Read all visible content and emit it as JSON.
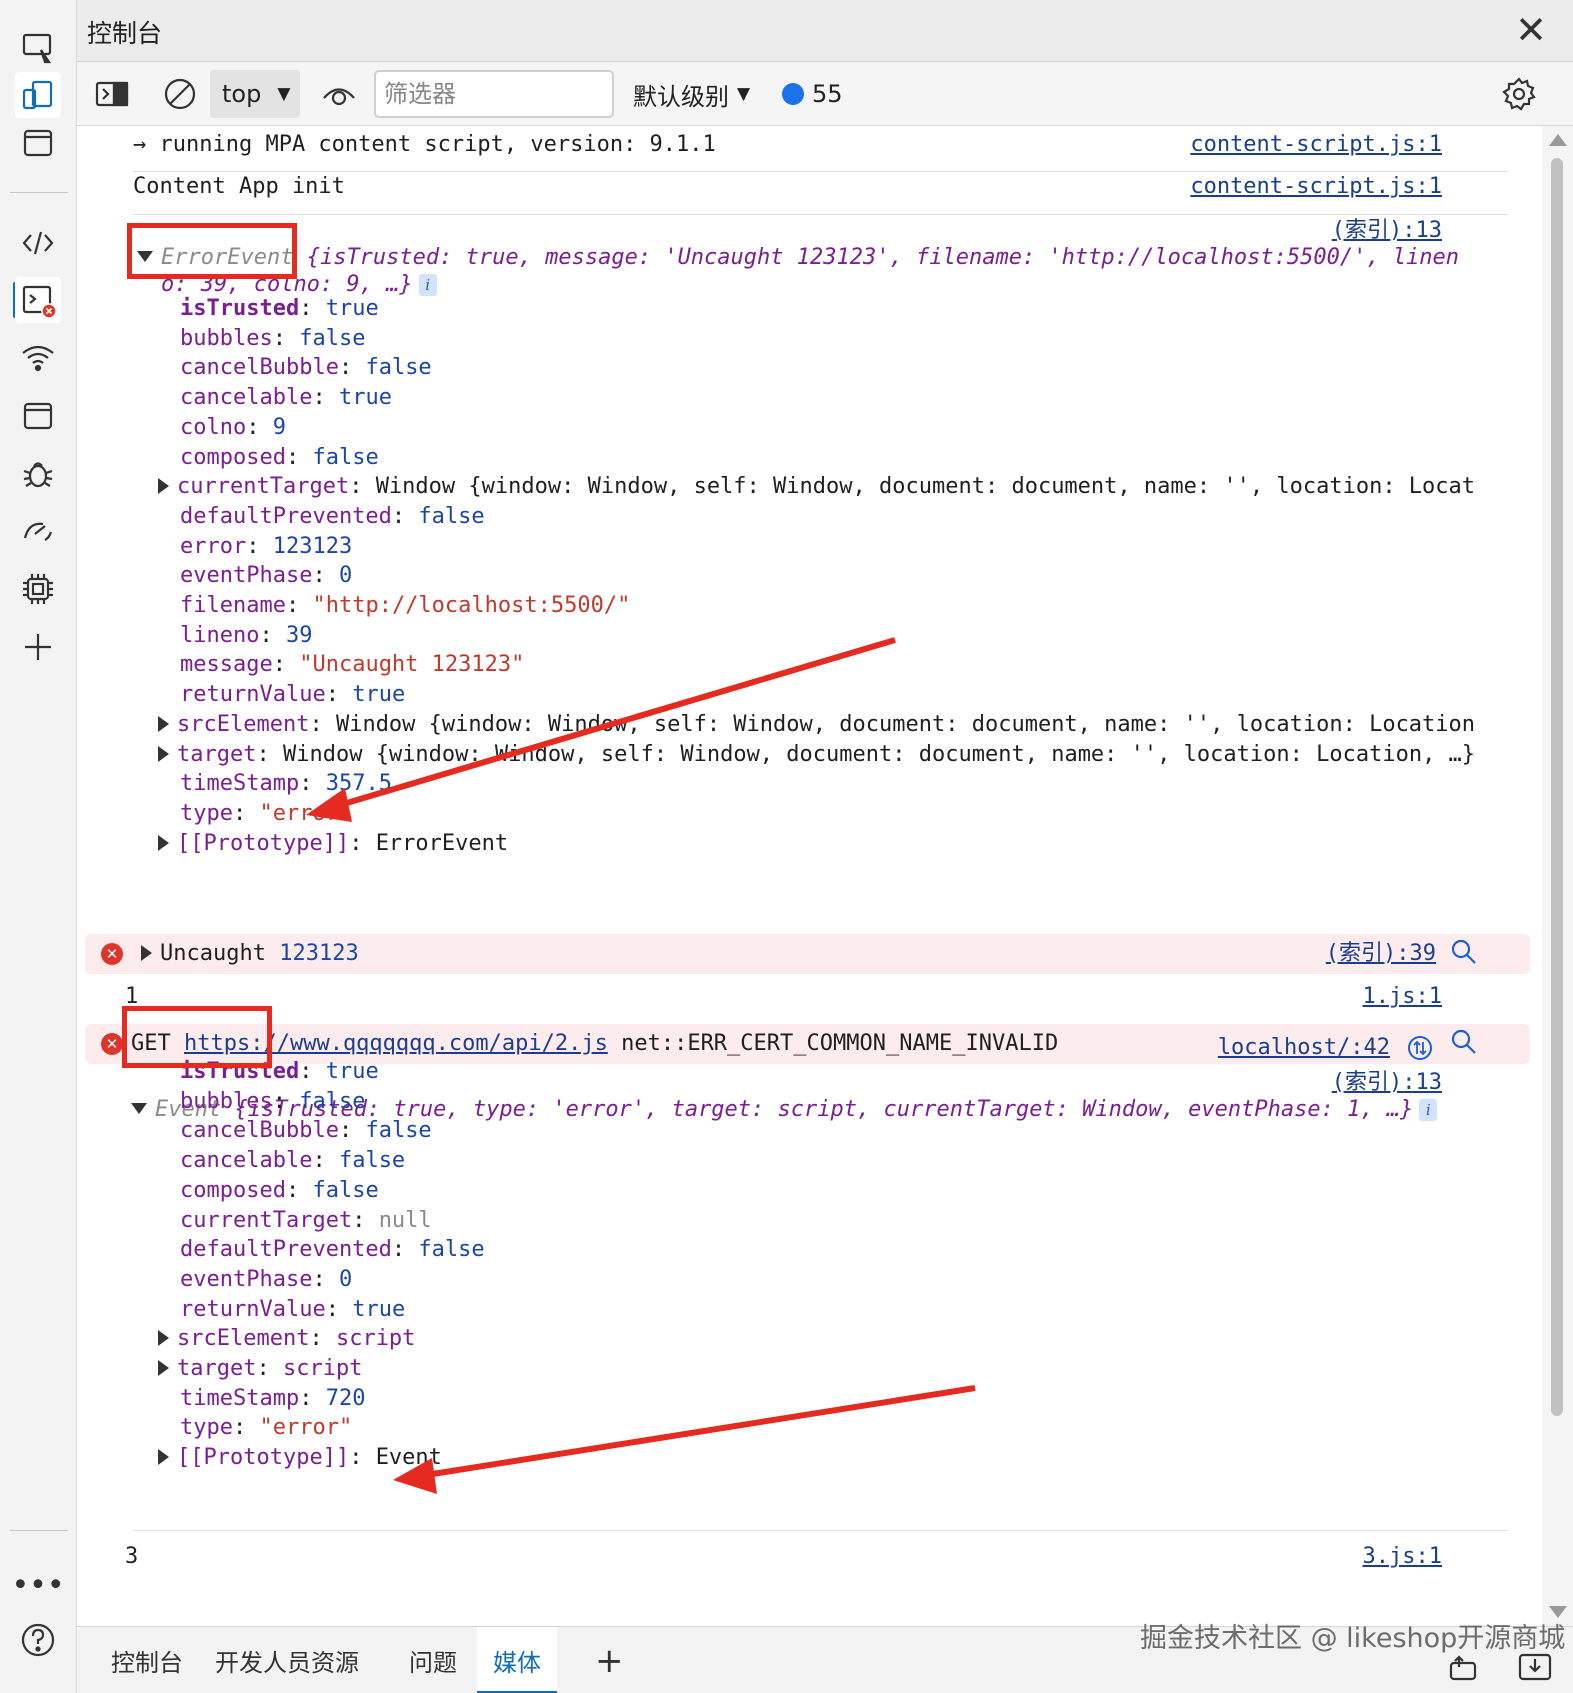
{
  "titlebar": {
    "title": "控制台",
    "close_icon": "close-icon"
  },
  "toolbar": {
    "context": "top",
    "filter_placeholder": "筛选器",
    "level": "默认级别",
    "message_count": "55"
  },
  "console": {
    "log1": {
      "text": "→ running MPA content script, version: 9.1.1",
      "source": "content-script.js:1"
    },
    "log2": {
      "text": "Content App init",
      "source": "content-script.js:1"
    },
    "errorevent": {
      "source": "(索引):13",
      "summary_type": "ErrorEvent",
      "summary_rest": "{isTrusted: true, message: 'Uncaught 123123', filename: 'http://localhost:5500/', linen",
      "summary_wrap": "o: 39, colno: 9, …}",
      "props": [
        {
          "key": "isTrusted",
          "val": "true",
          "kind": "b",
          "bold": true
        },
        {
          "key": "bubbles",
          "val": "false",
          "kind": "b"
        },
        {
          "key": "cancelBubble",
          "val": "false",
          "kind": "b"
        },
        {
          "key": "cancelable",
          "val": "true",
          "kind": "b"
        },
        {
          "key": "colno",
          "val": "9",
          "kind": "b"
        },
        {
          "key": "composed",
          "val": "false",
          "kind": "b"
        },
        {
          "key": "currentTarget",
          "val": "Window {window: Window, self: Window, document: document, name: '', location: Locat",
          "kind": "obj",
          "expand": true
        },
        {
          "key": "defaultPrevented",
          "val": "false",
          "kind": "b"
        },
        {
          "key": "error",
          "val": "123123",
          "kind": "b"
        },
        {
          "key": "eventPhase",
          "val": "0",
          "kind": "b"
        },
        {
          "key": "filename",
          "val": "\"http://localhost:5500/\"",
          "kind": "s"
        },
        {
          "key": "lineno",
          "val": "39",
          "kind": "b"
        },
        {
          "key": "message",
          "val": "\"Uncaught 123123\"",
          "kind": "s"
        },
        {
          "key": "returnValue",
          "val": "true",
          "kind": "b"
        },
        {
          "key": "srcElement",
          "val": "Window {window: Window, self: Window, document: document, name: '', location: Location",
          "kind": "obj",
          "expand": true
        },
        {
          "key": "target",
          "val": "Window {window: Window, self: Window, document: document, name: '', location: Location, …}",
          "kind": "obj",
          "expand": true
        },
        {
          "key": "timeStamp",
          "val": "357.5",
          "kind": "b"
        },
        {
          "key": "type",
          "val": "\"error\"",
          "kind": "s"
        },
        {
          "key": "[[Prototype]]",
          "val": "ErrorEvent",
          "kind": "d",
          "expand": true
        }
      ]
    },
    "uncaught": {
      "label": "Uncaught",
      "value": "123123",
      "source": "(索引):39"
    },
    "log3": {
      "text": "1",
      "source": "1.js:1"
    },
    "netError": {
      "method": "GET",
      "url": "https://www.qqqqqqq.com/api/2.js",
      "message": "net::ERR_CERT_COMMON_NAME_INVALID",
      "source": "localhost/:42"
    },
    "event": {
      "source": "(索引):13",
      "summary_type": "Event",
      "summary_rest": "{isTrusted: true, type: 'error', target: script, currentTarget: Window, eventPhase: 1, …}",
      "props": [
        {
          "key": "isTrusted",
          "val": "true",
          "kind": "b",
          "bold": true
        },
        {
          "key": "bubbles",
          "val": "false",
          "kind": "b"
        },
        {
          "key": "cancelBubble",
          "val": "false",
          "kind": "b"
        },
        {
          "key": "cancelable",
          "val": "false",
          "kind": "b"
        },
        {
          "key": "composed",
          "val": "false",
          "kind": "b"
        },
        {
          "key": "currentTarget",
          "val": "null",
          "kind": "g"
        },
        {
          "key": "defaultPrevented",
          "val": "false",
          "kind": "b"
        },
        {
          "key": "eventPhase",
          "val": "0",
          "kind": "b"
        },
        {
          "key": "returnValue",
          "val": "true",
          "kind": "b"
        },
        {
          "key": "srcElement",
          "val": "script",
          "kind": "k",
          "expand": true
        },
        {
          "key": "target",
          "val": "script",
          "kind": "k",
          "expand": true
        },
        {
          "key": "timeStamp",
          "val": "720",
          "kind": "b"
        },
        {
          "key": "type",
          "val": "\"error\"",
          "kind": "s"
        },
        {
          "key": "[[Prototype]]",
          "val": "Event",
          "kind": "d",
          "expand": true
        }
      ]
    },
    "log4": {
      "text": "3",
      "source": "3.js:1"
    }
  },
  "drawer": {
    "tabs": [
      "控制台",
      "开发人员资源",
      "问题",
      "媒体"
    ],
    "active_tab": "媒体"
  },
  "watermark": "掘金技术社区 @ likeshop开源商城",
  "colors": {
    "accent": "#0f6cbd",
    "error_bg": "#fdecee",
    "annotation_red": "#e52a1f"
  }
}
